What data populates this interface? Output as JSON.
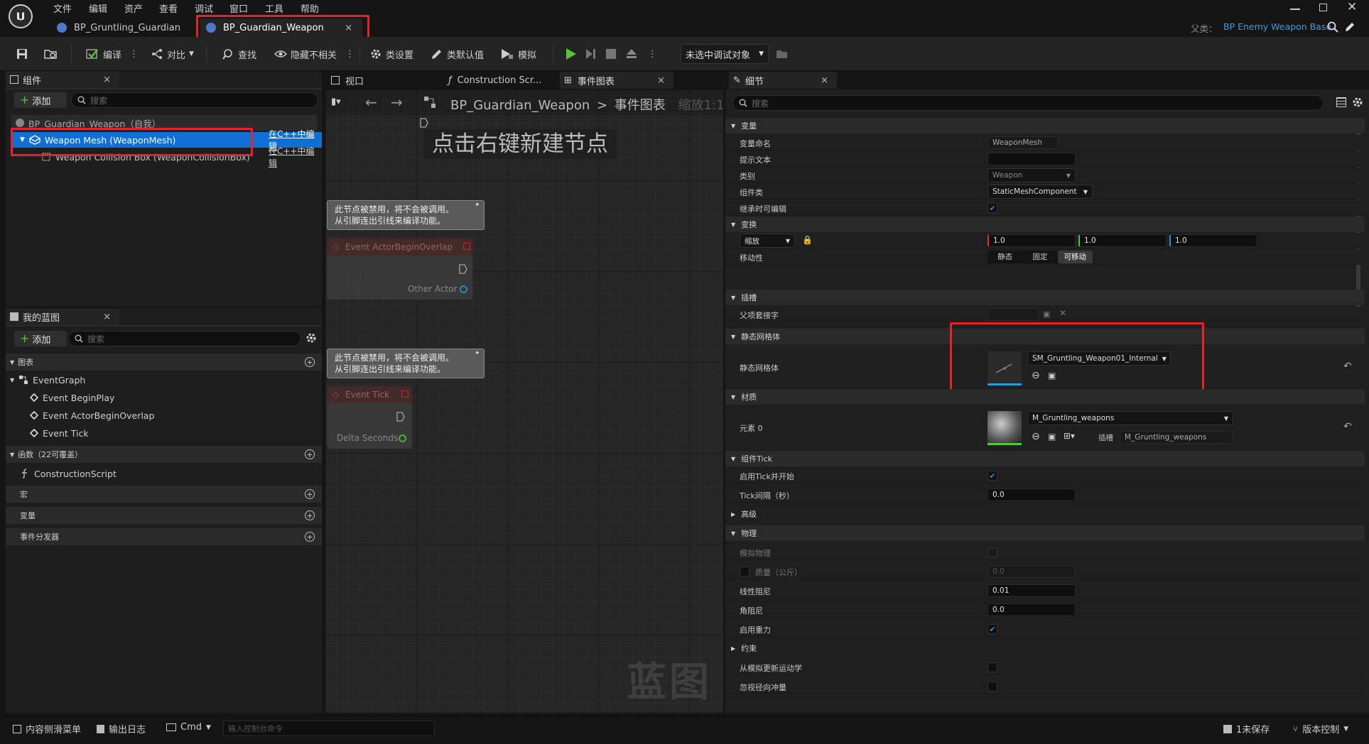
{
  "menu": [
    "文件",
    "编辑",
    "资产",
    "查看",
    "调试",
    "窗口",
    "工具",
    "帮助"
  ],
  "doc_tabs": [
    {
      "label": "BP_Gruntling_Guardian"
    },
    {
      "label": "BP_Guardian_Weapon",
      "close": "×"
    }
  ],
  "parent_class": {
    "label": "父类：",
    "value": "BP Enemy Weapon Base"
  },
  "toolbar": {
    "compile": "编译",
    "diff": "对比",
    "find": "查找",
    "hide_unrelated": "隐藏不相关",
    "class_settings": "类设置",
    "class_defaults": "类默认值",
    "simulate": "模拟",
    "debug_target": "未选中调试对象"
  },
  "components_panel": {
    "tab": "组件",
    "close": "×",
    "add": "添加",
    "search_placeholder": "搜索",
    "root": "BP_Guardian_Weapon（自我）",
    "items": [
      {
        "label": "Weapon Mesh (WeaponMesh)",
        "action": "在C++中编辑"
      },
      {
        "label": "Weapon Collision Box (WeaponCollisionBox)",
        "action": "在C++中编辑"
      }
    ]
  },
  "my_blueprint": {
    "tab": "我的蓝图",
    "close": "×",
    "add": "添加",
    "search_placeholder": "搜索",
    "graphs_header": "图表",
    "event_graph": "EventGraph",
    "events": [
      "Event BeginPlay",
      "Event ActorBeginOverlap",
      "Event Tick"
    ],
    "functions_header": "函数（22可覆盖）",
    "construction_script": "ConstructionScript",
    "macros_header": "宏",
    "variables_header": "变量",
    "dispatchers_header": "事件分发器"
  },
  "graph_tabs": [
    {
      "label": "视口"
    },
    {
      "label": "Construction Scr..."
    },
    {
      "label": "事件图表",
      "close": "×"
    }
  ],
  "graph": {
    "breadcrumb_root": "BP_Guardian_Weapon",
    "breadcrumb_sep": ">",
    "breadcrumb_leaf": "事件图表",
    "zoom": "缩放1:1",
    "hint": "点击右键新建节点",
    "disabled_note_line1": "此节点被禁用，将不会被调用。",
    "disabled_note_line2": "从引脚连出引线来编译功能。",
    "node_overlap": "Event ActorBeginOverlap",
    "pin_other_actor": "Other Actor",
    "node_tick": "Event Tick",
    "pin_delta": "Delta Seconds",
    "watermark": "蓝图"
  },
  "details": {
    "tab": "细节",
    "close": "×",
    "search_placeholder": "搜索",
    "cat_variable": "变量",
    "var_name_label": "变量命名",
    "var_name_value": "WeaponMesh",
    "tooltip_label": "提示文本",
    "category_label": "类别",
    "category_value": "Weapon",
    "comp_class_label": "组件类",
    "comp_class_value": "StaticMeshComponent",
    "editable_label": "继承时可编辑",
    "cat_transform": "变换",
    "scale_label": "缩放",
    "scale_x": "1.0",
    "scale_y": "1.0",
    "scale_z": "1.0",
    "mobility_label": "移动性",
    "mob_static": "静态",
    "mob_stationary": "固定",
    "mob_movable": "可移动",
    "cat_sockets": "插槽",
    "parent_socket_label": "父项套接字",
    "cat_static_mesh": "静态网格体",
    "static_mesh_label": "静态网格体",
    "static_mesh_value": "SM_Gruntling_Weapon01_Internal",
    "cat_materials": "材质",
    "element_label": "元素 0",
    "material_value": "M_Gruntling_weapons",
    "slot_label": "插槽",
    "slot_value": "M_Gruntling_weapons",
    "cat_tick": "组件Tick",
    "tick_start_label": "启用Tick并开始",
    "tick_interval_label": "Tick间隔（秒）",
    "tick_interval_value": "0.0",
    "cat_advanced": "高级",
    "cat_physics": "物理",
    "simulate_label": "模拟物理",
    "mass_label": "质量（公斤）",
    "mass_value": "0.0",
    "linear_damp_label": "线性阻尼",
    "linear_damp_value": "0.01",
    "angular_damp_label": "角阻尼",
    "angular_damp_value": "0.0",
    "gravity_label": "启用重力",
    "cat_constraints": "约束",
    "update_sim_label": "从模拟更新运动学",
    "ignore_radial_label": "忽视径向冲量"
  },
  "statusbar": {
    "content_drawer": "内容侧滑菜单",
    "output_log": "输出日志",
    "cmd": "Cmd",
    "console_placeholder": "输入控制台命令",
    "unsaved": "1未保存",
    "source_control": "版本控制"
  },
  "colors": {
    "accent": "#0e70d6",
    "highlight": "#e8222b",
    "play": "#53c63a"
  }
}
